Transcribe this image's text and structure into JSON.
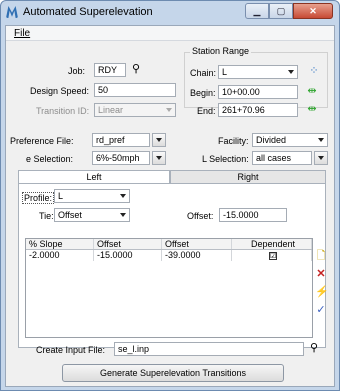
{
  "window": {
    "title": "Automated Superelevation"
  },
  "menu": {
    "file": "File"
  },
  "main": {
    "job_label": "Job:",
    "job_value": "RDY",
    "design_speed_label": "Design Speed:",
    "design_speed_value": "50",
    "transition_id_label": "Transition ID:",
    "transition_id_value": "Linear",
    "station_range_title": "Station Range",
    "chain_label": "Chain:",
    "chain_value": "L",
    "begin_label": "Begin:",
    "begin_value": "10+00.00",
    "end_label": "End:",
    "end_value": "261+70.96",
    "pref_file_label": "Preference File:",
    "pref_file_value": "rd_pref",
    "facility_label": "Facility:",
    "facility_value": "Divided",
    "e_selection_label": "e Selection:",
    "e_selection_value": "6%-50mph",
    "l_selection_label": "L Selection:",
    "l_selection_value": "all cases"
  },
  "tabs": {
    "left": "Left",
    "right": "Right"
  },
  "panel": {
    "profile_label": "Profile:",
    "profile_value": "L",
    "tie_label": "Tie:",
    "tie_value": "Offset",
    "offset_label": "Offset:",
    "offset_value": "-15.0000",
    "columns": [
      "% Slope",
      "Offset",
      "Offset",
      "Dependent"
    ],
    "rows": [
      {
        "slope": "-2.0000",
        "offset1": "-15.0000",
        "offset2": "-39.0000",
        "dependent": "☑"
      }
    ]
  },
  "footer": {
    "create_input_label": "Create Input File:",
    "create_input_value": "se_l.inp",
    "generate_button": "Generate Superelevation Transitions"
  },
  "icons": {
    "search": "search-icon",
    "pick": "pick-element-icon",
    "arrows": "move-arrows-icon",
    "add_row": "add-row-icon",
    "delete": "delete-icon",
    "lightning": "lightning-icon",
    "check": "check-icon"
  }
}
